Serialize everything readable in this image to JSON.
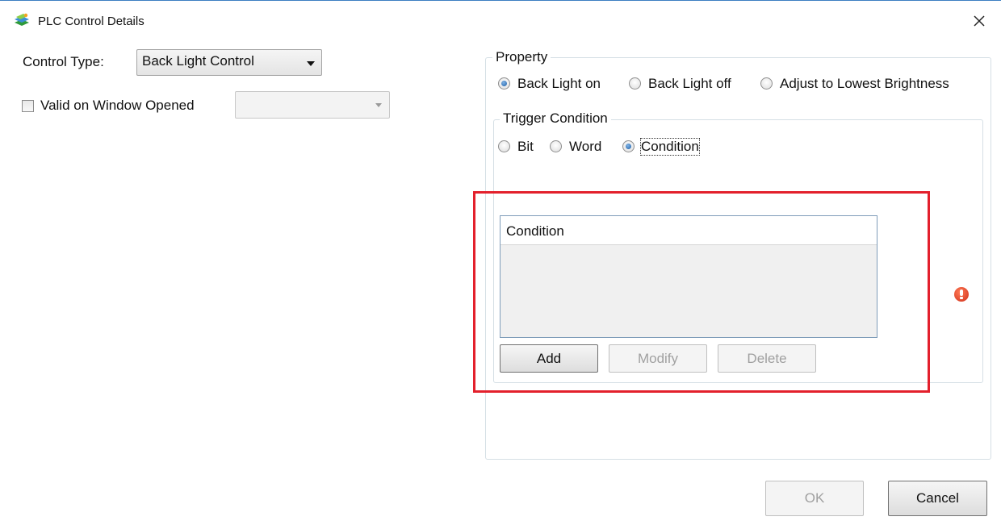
{
  "window": {
    "title": "PLC Control Details",
    "icon": "plc-app-icon",
    "close_icon": "close-icon"
  },
  "left_panel": {
    "control_type_label": "Control Type:",
    "control_type_value": "Back Light Control",
    "valid_on_window_opened_label": "Valid on Window Opened",
    "valid_on_window_opened_checked": false,
    "window_select_value": ""
  },
  "property": {
    "title": "Property",
    "options": [
      {
        "label": "Back Light on",
        "checked": true
      },
      {
        "label": "Back Light off",
        "checked": false
      },
      {
        "label": "Adjust to Lowest Brightness",
        "checked": false
      }
    ]
  },
  "trigger": {
    "title": "Trigger Condition",
    "options": [
      {
        "label": "Bit",
        "checked": false
      },
      {
        "label": "Word",
        "checked": false
      },
      {
        "label": "Condition",
        "checked": true
      }
    ],
    "list_header": "Condition",
    "rows": [],
    "add_label": "Add",
    "modify_label": "Modify",
    "delete_label": "Delete"
  },
  "footer": {
    "ok_label": "OK",
    "cancel_label": "Cancel"
  },
  "colors": {
    "accent": "#1d5fa8",
    "highlight": "#e3202c",
    "error": "#d0301b"
  }
}
